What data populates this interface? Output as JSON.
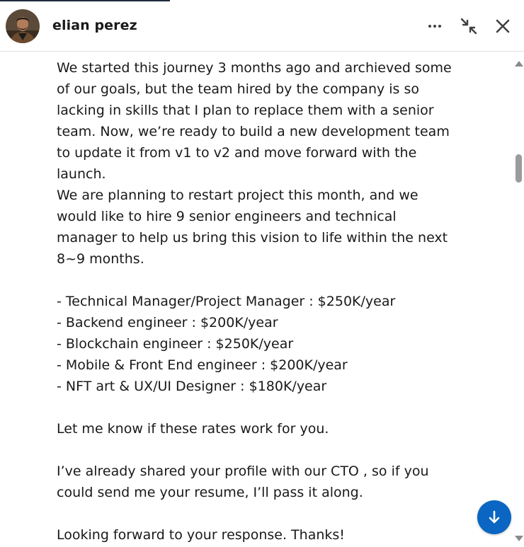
{
  "header": {
    "contact_name": "elian perez",
    "avatar_icon": "profile-photo",
    "more_icon": "ellipsis-icon",
    "minimize_icon": "collapse-arrows-icon",
    "close_icon": "close-icon"
  },
  "message": {
    "paragraph_1": "We started this journey 3 months ago and archieved some of our goals, but the team hired by the company is so lacking in skills that I plan to replace them with a senior team. Now, we’re ready to build a new development team to update it from v1 to v2 and move forward with the launch.",
    "paragraph_2": "We are planning to restart project this month, and we would like to hire 9 senior engineers and technical manager to help us bring this vision to life within the next 8~9 months.",
    "roles": [
      "- Technical Manager/Project Manager : $250K/year",
      "- Backend engineer : $200K/year",
      "- Blockchain engineer : $250K/year",
      "- Mobile & Front End engineer : $200K/year",
      "- NFT art & UX/UI Designer : $180K/year"
    ],
    "paragraph_3": "Let me know if these rates work for you.",
    "paragraph_4": "I’ve already shared your profile with our CTO , so if you could send me your resume, I’ll pass it along.",
    "paragraph_5": "Looking forward to your response. Thanks!"
  },
  "colors": {
    "accent": "#0a66c2",
    "text": "#191919",
    "scrollbar_thumb": "#9b9b9b"
  },
  "scroll_to_bottom_icon": "arrow-down-icon"
}
